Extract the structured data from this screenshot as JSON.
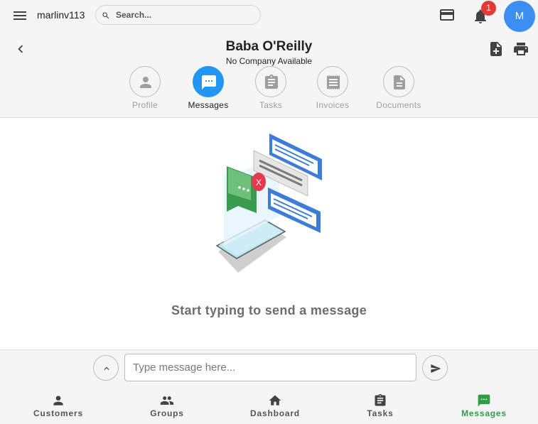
{
  "topbar": {
    "username": "marlinv113",
    "search_placeholder": "Search...",
    "notification_count": "1",
    "avatar_initial": "M"
  },
  "contact": {
    "name": "Baba O'Reilly",
    "company": "No Company Available"
  },
  "tabs": [
    {
      "label": "Profile",
      "icon": "person-icon",
      "active": false
    },
    {
      "label": "Messages",
      "icon": "chat-icon",
      "active": true
    },
    {
      "label": "Tasks",
      "icon": "clipboard-icon",
      "active": false
    },
    {
      "label": "Invoices",
      "icon": "receipt-icon",
      "active": false
    },
    {
      "label": "Documents",
      "icon": "document-icon",
      "active": false
    }
  ],
  "main": {
    "empty_message": "Start typing to send a message"
  },
  "composer": {
    "placeholder": "Type message here..."
  },
  "bottom_nav": [
    {
      "label": "Customers",
      "icon": "person-icon",
      "active": false
    },
    {
      "label": "Groups",
      "icon": "groups-icon",
      "active": false
    },
    {
      "label": "Dashboard",
      "icon": "home-icon",
      "active": false
    },
    {
      "label": "Tasks",
      "icon": "clipboard-icon",
      "active": false
    },
    {
      "label": "Messages",
      "icon": "chat-icon",
      "active": true
    }
  ],
  "colors": {
    "accent": "#2196f3",
    "active_nav": "#2e9e45",
    "badge": "#e53935",
    "avatar": "#3b8ff0"
  }
}
